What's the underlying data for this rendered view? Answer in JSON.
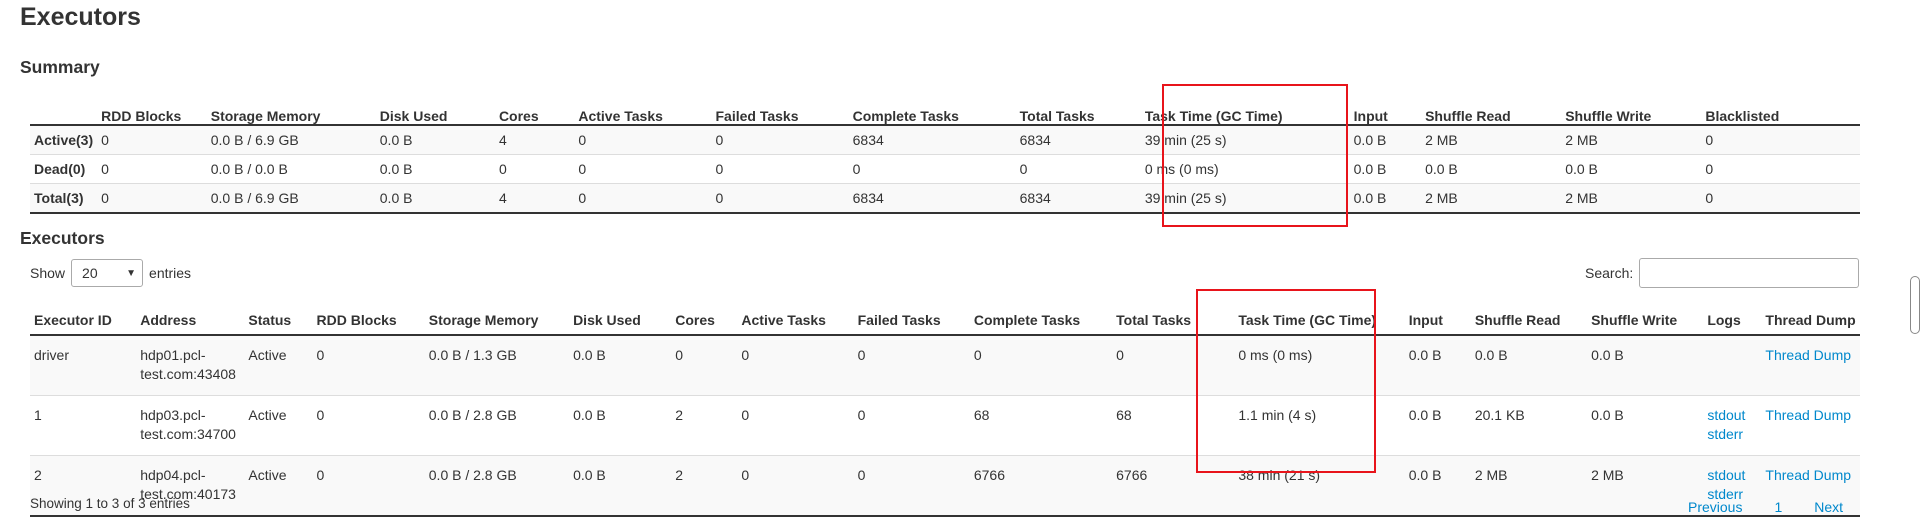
{
  "page": {
    "title": "Executors"
  },
  "summary": {
    "heading": "Summary",
    "columns": [
      "",
      "RDD Blocks",
      "Storage Memory",
      "Disk Used",
      "Cores",
      "Active Tasks",
      "Failed Tasks",
      "Complete Tasks",
      "Total Tasks",
      "Task Time (GC Time)",
      "Input",
      "Shuffle Read",
      "Shuffle Write",
      "Blacklisted"
    ],
    "rows": [
      [
        "Active(3)",
        "0",
        "0.0 B / 6.9 GB",
        "0.0 B",
        "4",
        "0",
        "0",
        "6834",
        "6834",
        "39 min (25 s)",
        "0.0 B",
        "2 MB",
        "2 MB",
        "0"
      ],
      [
        "Dead(0)",
        "0",
        "0.0 B / 0.0 B",
        "0.0 B",
        "0",
        "0",
        "0",
        "0",
        "0",
        "0 ms (0 ms)",
        "0.0 B",
        "0.0 B",
        "0.0 B",
        "0"
      ],
      [
        "Total(3)",
        "0",
        "0.0 B / 6.9 GB",
        "0.0 B",
        "4",
        "0",
        "0",
        "6834",
        "6834",
        "39 min (25 s)",
        "0.0 B",
        "2 MB",
        "2 MB",
        "0"
      ]
    ]
  },
  "executors": {
    "heading": "Executors",
    "show_label": "Show",
    "entries_label": "entries",
    "page_size": "20",
    "search_label": "Search:",
    "search_value": "",
    "columns": [
      "Executor ID",
      "Address",
      "Status",
      "RDD Blocks",
      "Storage Memory",
      "Disk Used",
      "Cores",
      "Active Tasks",
      "Failed Tasks",
      "Complete Tasks",
      "Total Tasks",
      "Task Time (GC Time)",
      "Input",
      "Shuffle Read",
      "Shuffle Write",
      "Logs",
      "Thread Dump"
    ],
    "rows": [
      {
        "id": "driver",
        "address_1": "hdp01.pcl-",
        "address_2": "test.com:43408",
        "status": "Active",
        "rdd_blocks": "0",
        "storage_memory": "0.0 B / 1.3 GB",
        "disk_used": "0.0 B",
        "cores": "0",
        "active_tasks": "0",
        "failed_tasks": "0",
        "complete_tasks": "0",
        "total_tasks": "0",
        "task_time": "0 ms (0 ms)",
        "input": "0.0 B",
        "shuffle_read": "0.0 B",
        "shuffle_write": "0.0 B",
        "log_stdout": "",
        "log_stderr": "",
        "thread_dump": "Thread Dump"
      },
      {
        "id": "1",
        "address_1": "hdp03.pcl-",
        "address_2": "test.com:34700",
        "status": "Active",
        "rdd_blocks": "0",
        "storage_memory": "0.0 B / 2.8 GB",
        "disk_used": "0.0 B",
        "cores": "2",
        "active_tasks": "0",
        "failed_tasks": "0",
        "complete_tasks": "68",
        "total_tasks": "68",
        "task_time": "1.1 min (4 s)",
        "input": "0.0 B",
        "shuffle_read": "20.1 KB",
        "shuffle_write": "0.0 B",
        "log_stdout": "stdout",
        "log_stderr": "stderr",
        "thread_dump": "Thread Dump"
      },
      {
        "id": "2",
        "address_1": "hdp04.pcl-",
        "address_2": "test.com:40173",
        "status": "Active",
        "rdd_blocks": "0",
        "storage_memory": "0.0 B / 2.8 GB",
        "disk_used": "0.0 B",
        "cores": "2",
        "active_tasks": "0",
        "failed_tasks": "0",
        "complete_tasks": "6766",
        "total_tasks": "6766",
        "task_time": "38 min (21 s)",
        "input": "0.0 B",
        "shuffle_read": "2 MB",
        "shuffle_write": "2 MB",
        "log_stdout": "stdout",
        "log_stderr": "stderr",
        "thread_dump": "Thread Dump"
      }
    ],
    "info": "Showing 1 to 3 of 3 entries",
    "pager": {
      "previous": "Previous",
      "current": "1",
      "next": "Next"
    }
  },
  "colors": {
    "highlight": "#e8141b",
    "link": "#0088cc"
  },
  "icons": {
    "page_size_select": "chevron-down-icon"
  }
}
